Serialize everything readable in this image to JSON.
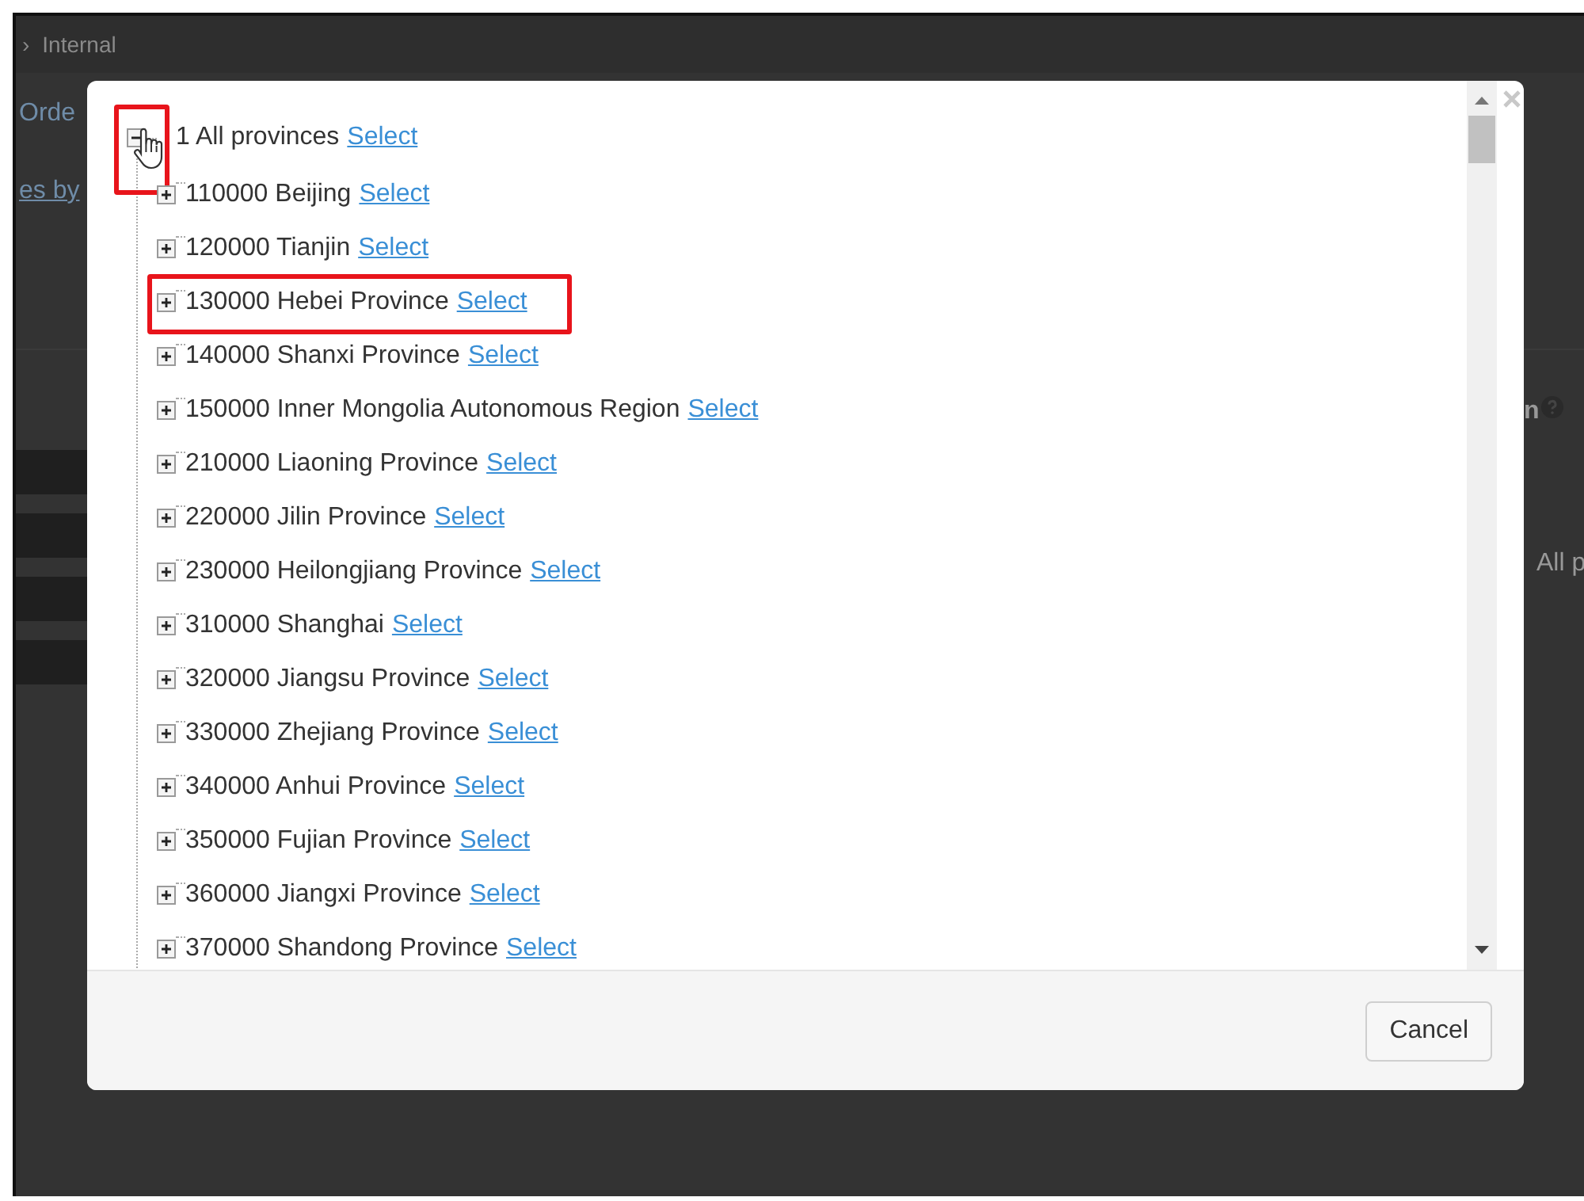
{
  "background_page": {
    "breadcrumb_separator": "›",
    "breadcrumb": "Internal",
    "tab_text": "Orde",
    "link_text": "es by",
    "field_label": "n",
    "field_value": "All p"
  },
  "dialog": {
    "tree": {
      "label": "1 All provinces",
      "link": "Select",
      "expanded": true,
      "highlighted": true,
      "children": [
        {
          "label": "110000 Beijing",
          "link": "Select",
          "expanded": false,
          "highlighted": false
        },
        {
          "label": "120000 Tianjin",
          "link": "Select",
          "expanded": false,
          "highlighted": false
        },
        {
          "label": "130000 Hebei Province",
          "link": "Select",
          "expanded": false,
          "highlighted": true
        },
        {
          "label": "140000 Shanxi Province",
          "link": "Select",
          "expanded": false,
          "highlighted": false
        },
        {
          "label": "150000 Inner Mongolia Autonomous Region",
          "link": "Select",
          "expanded": false,
          "highlighted": false
        },
        {
          "label": "210000 Liaoning Province",
          "link": "Select",
          "expanded": false,
          "highlighted": false
        },
        {
          "label": "220000 Jilin Province",
          "link": "Select",
          "expanded": false,
          "highlighted": false
        },
        {
          "label": "230000 Heilongjiang Province",
          "link": "Select",
          "expanded": false,
          "highlighted": false
        },
        {
          "label": "310000 Shanghai",
          "link": "Select",
          "expanded": false,
          "highlighted": false
        },
        {
          "label": "320000 Jiangsu Province",
          "link": "Select",
          "expanded": false,
          "highlighted": false
        },
        {
          "label": "330000 Zhejiang Province",
          "link": "Select",
          "expanded": false,
          "highlighted": false
        },
        {
          "label": "340000 Anhui Province",
          "link": "Select",
          "expanded": false,
          "highlighted": false
        },
        {
          "label": "350000 Fujian Province",
          "link": "Select",
          "expanded": false,
          "highlighted": false
        },
        {
          "label": "360000 Jiangxi Province",
          "link": "Select",
          "expanded": false,
          "highlighted": false
        },
        {
          "label": "370000 Shandong Province",
          "link": "Select",
          "expanded": false,
          "highlighted": false
        }
      ]
    },
    "buttons": [
      "Cancel"
    ]
  }
}
